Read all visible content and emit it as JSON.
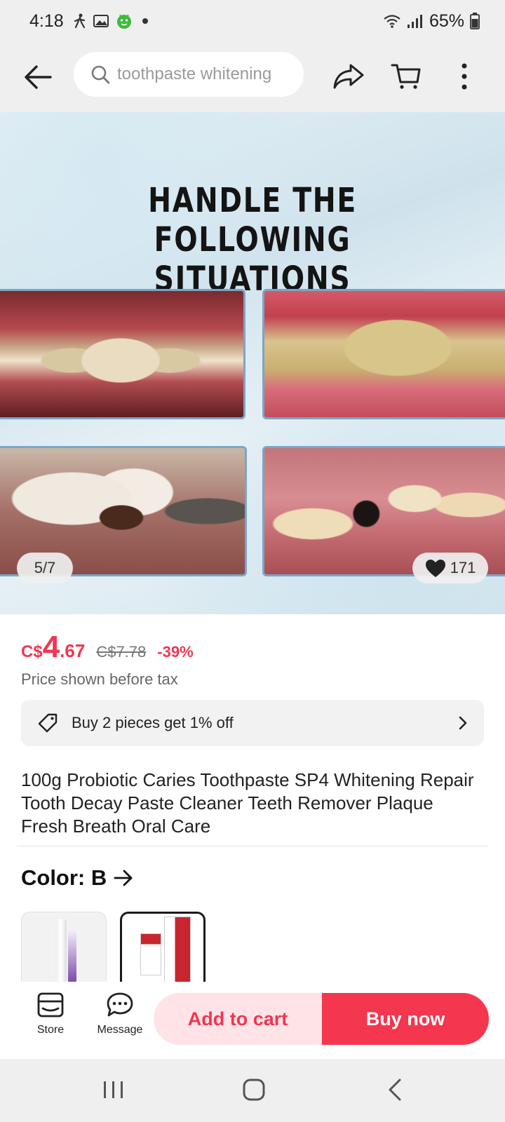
{
  "status_bar": {
    "time": "4:18",
    "battery": "65%",
    "icons": [
      "walk-icon",
      "gallery-icon",
      "android-icon",
      "wifi-icon",
      "signal-icon",
      "battery-icon"
    ]
  },
  "top_nav": {
    "search_placeholder": "toothpaste whitening",
    "icons": [
      "back-arrow-icon",
      "search-icon",
      "share-icon",
      "cart-icon",
      "more-vertical-icon"
    ]
  },
  "gallery": {
    "headline_line1": "HANDLE THE FOLLOWING",
    "headline_line2": "SITUATIONS",
    "pager": "5/7",
    "likes": "171"
  },
  "price": {
    "currency": "C$",
    "integer": "4",
    "decimal": ".67",
    "original": "C$7.78",
    "discount": "-39%",
    "tax_note": "Price shown before tax"
  },
  "promo": {
    "text": "Buy 2 pieces get 1% off"
  },
  "product": {
    "title": "100g Probiotic Caries Toothpaste SP4 Whitening Repair Tooth Decay Paste Cleaner Teeth Remover Plaque Fresh Breath Oral Care",
    "color_label": "Color: B",
    "selected_color": "B"
  },
  "actions": {
    "store_label": "Store",
    "message_label": "Message",
    "add_to_cart": "Add to cart",
    "buy_now": "Buy now"
  },
  "colors": {
    "accent": "#f03652",
    "accent_light": "#ffe3e6",
    "bar_bg": "#efefef"
  }
}
